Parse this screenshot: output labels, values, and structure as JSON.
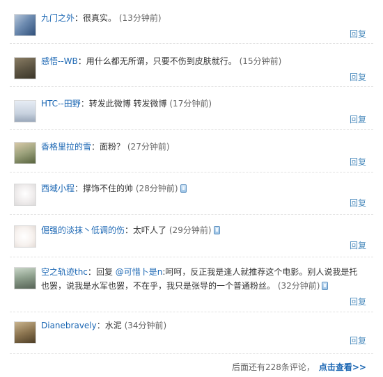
{
  "comments": [
    {
      "name": "九门之外",
      "text": "很真实。",
      "time": "(13分钟前)",
      "reply": "回复",
      "phone": false
    },
    {
      "name": "感悟--WB",
      "text": "用什么都无所谓，只要不伤到皮肤就行。",
      "time": "(15分钟前)",
      "reply": "回复",
      "phone": false
    },
    {
      "name": "HTC--田野",
      "text": "转发此微博 转发微博",
      "time": "(17分钟前)",
      "reply": "回复",
      "phone": false
    },
    {
      "name": "香格里拉的雪",
      "text": "面粉？",
      "time": "(27分钟前)",
      "reply": "回复",
      "phone": false
    },
    {
      "name": "西域小程",
      "text": "撑饰不住的帅",
      "time": "(28分钟前)",
      "reply": "回复",
      "phone": true
    },
    {
      "name": "倔强的淡抹丶低调的伤",
      "text": "太吓人了",
      "time": "(29分钟前)",
      "reply": "回复",
      "phone": true
    },
    {
      "name": "空之轨迹thc",
      "reply_prefix": "回复",
      "mention": "@可惜卜是n",
      "text": ":呵呵，反正我是逢人就推荐这个电影。别人说我是托也罢，说我是水军也罢，不在乎，我只是张导的一个普通粉丝。",
      "time": "(32分钟前)",
      "reply": "回复",
      "phone": true
    },
    {
      "name": "Dianebravely",
      "text": "水泥",
      "time": "(34分钟前)",
      "reply": "回复",
      "phone": false
    }
  ],
  "footer": {
    "prefix": "后面还有228条评论，",
    "link": "点击查看>>"
  },
  "colors": {
    "name": "#1a66b3",
    "reply": "#4b8bbd",
    "separator": "#e2e2e2"
  },
  "icons": {
    "phone": "phone-icon"
  }
}
